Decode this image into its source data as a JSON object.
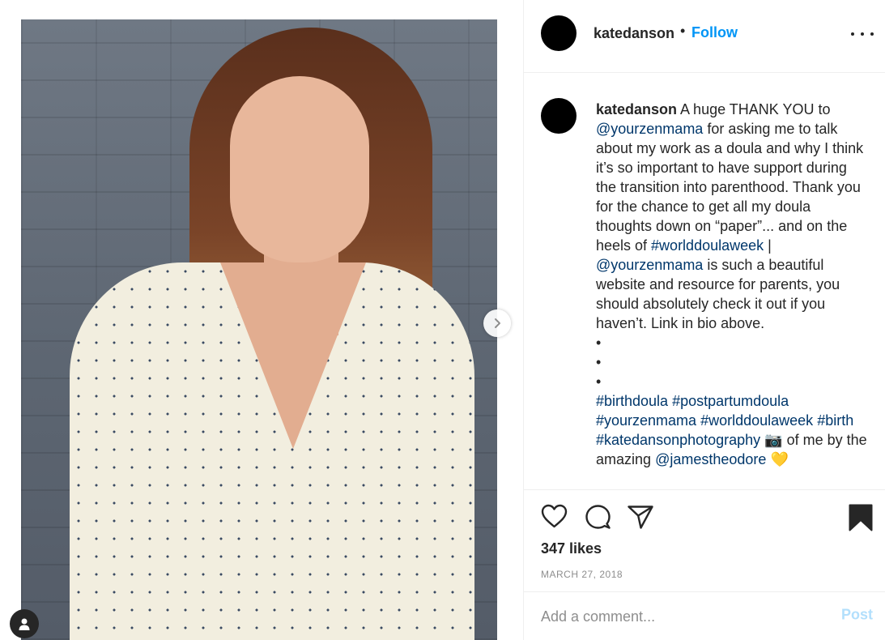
{
  "post": {
    "photo_alt": "",
    "next_icon": "chevron-right-icon",
    "tag_icon": "user-tag-icon"
  },
  "header": {
    "username": "katedanson",
    "separator": "•",
    "follow_label": "Follow",
    "more_icon": "more-options-icon"
  },
  "caption": {
    "username": "katedanson",
    "parts": [
      {
        "text": " A huge THANK YOU to ",
        "type": "text"
      },
      {
        "text": "@yourzenmama",
        "type": "link"
      },
      {
        "text": " for asking me to talk about my work as a doula and why I think it’s so important to have support during the transition into parenthood. Thank you for the chance to get all my doula thoughts down on “paper”... and on the heels of ",
        "type": "text"
      },
      {
        "text": "#worlddoulaweek",
        "type": "link"
      },
      {
        "text": " | ",
        "type": "text"
      },
      {
        "text": "@yourzenmama",
        "type": "link"
      },
      {
        "text": " is such a beautiful website and resource for parents, you should absolutely check it out if you haven’t. Link in bio above.",
        "type": "text"
      }
    ],
    "bullets": [
      "•",
      "•",
      "•"
    ],
    "hashtags": [
      "#birthdoula",
      "#postpartumdoula",
      "#yourzenmama",
      "#worlddoulaweek",
      "#birth",
      "#katedansonphotography"
    ],
    "camera_emoji": "📷",
    "credit_text": "of me by the amazing",
    "credit_mention": "@jamestheodore",
    "heart_emoji": "💛"
  },
  "actions": {
    "like_icon": "heart-icon",
    "comment_icon": "comment-icon",
    "share_icon": "share-icon",
    "save_icon": "bookmark-icon",
    "likes": "347 likes",
    "date": "MARCH 27, 2018"
  },
  "comment_box": {
    "placeholder": "Add a comment...",
    "post_label": "Post"
  },
  "colors": {
    "accent": "#0095f6",
    "link": "#00376b",
    "post_disabled": "#b2dffc",
    "muted": "#8e8e8e"
  }
}
